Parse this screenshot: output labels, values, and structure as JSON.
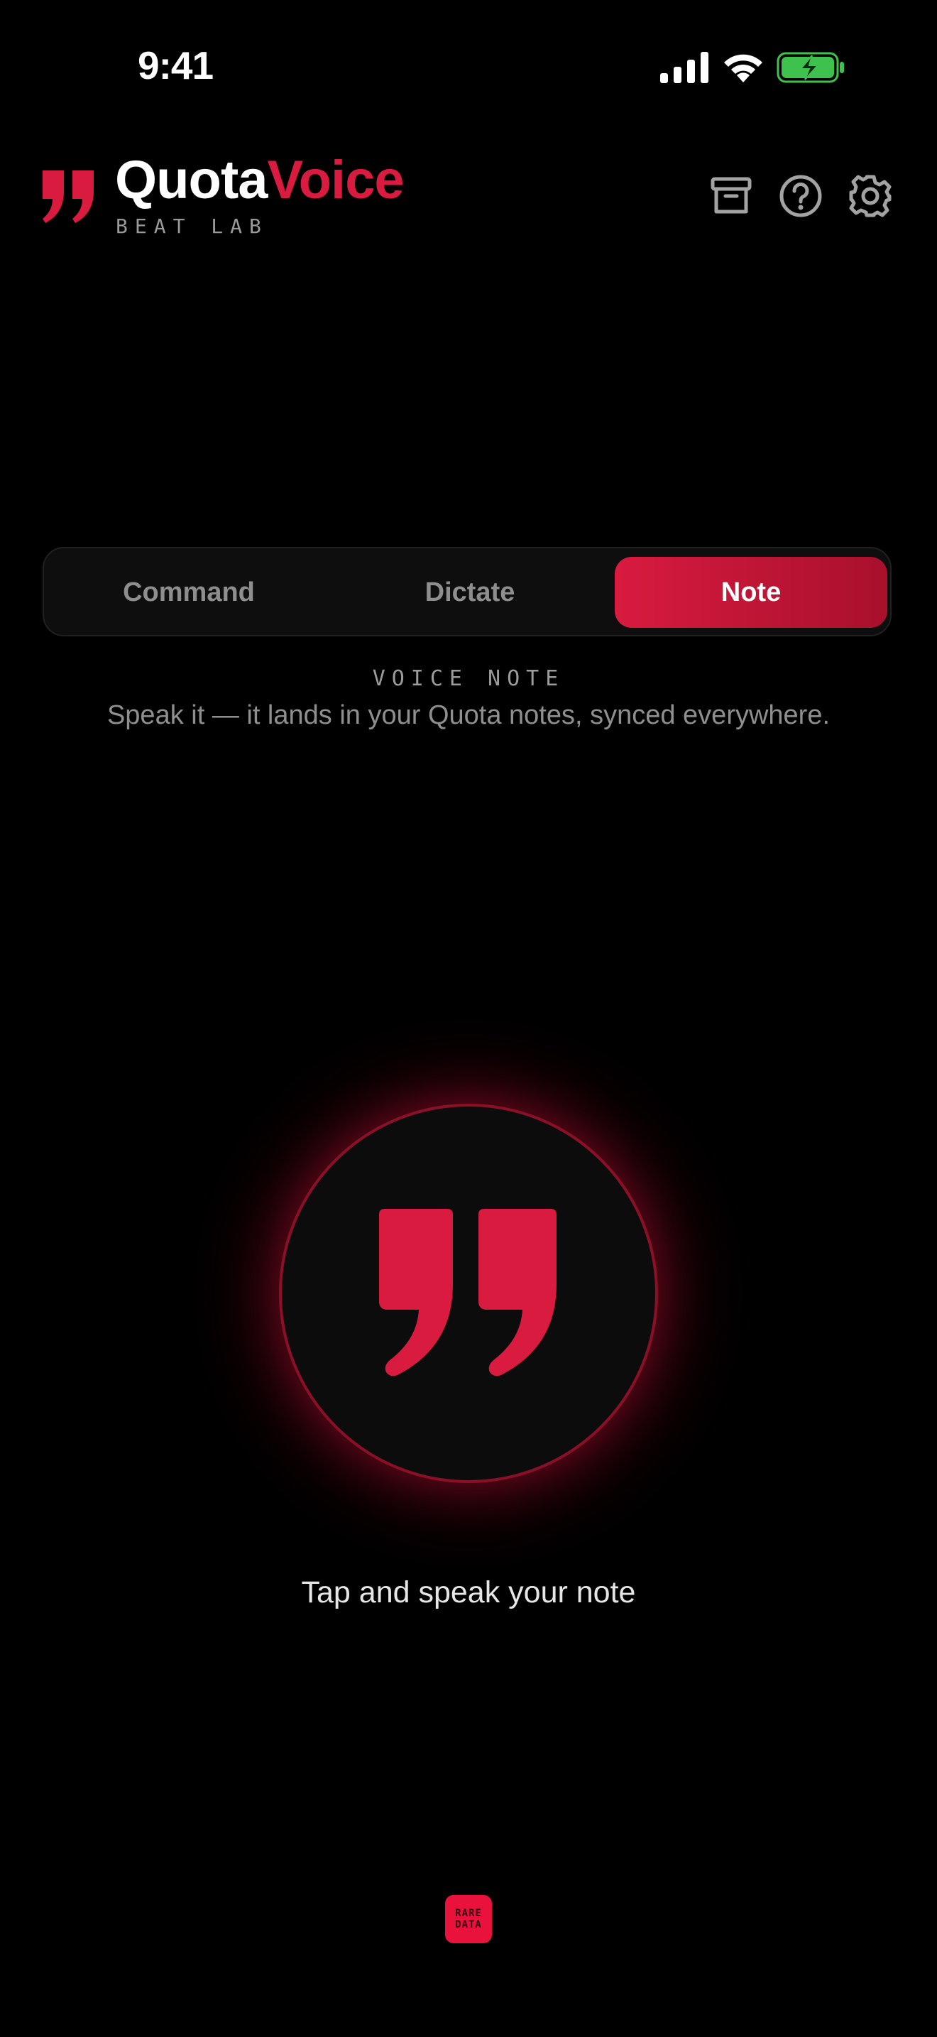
{
  "status_bar": {
    "time": "9:41",
    "icons": [
      "cellular-signal-icon",
      "wifi-icon",
      "battery-charging-icon"
    ]
  },
  "header": {
    "brand_name_part1": "Quota",
    "brand_name_part2": "Voice",
    "brand_subtitle": "BEAT LAB",
    "brand_icon": "quote-mark-icon",
    "actions": [
      "archive-icon",
      "help-icon",
      "settings-gear-icon"
    ]
  },
  "modes": {
    "tabs": [
      "Command",
      "Dictate",
      "Note"
    ],
    "selected": "Note",
    "caption": "VOICE NOTE",
    "description": "Speak it — it lands in your Quota notes, synced everywhere."
  },
  "mic": {
    "icon": "quote-mark-icon",
    "prompt": "Tap and speak your note"
  },
  "footer": {
    "logo_line1": "RARE",
    "logo_line2": "DATA"
  },
  "colors": {
    "background": "#000000",
    "accent": "#d81b3f",
    "muted_text": "#8f8f8f"
  }
}
